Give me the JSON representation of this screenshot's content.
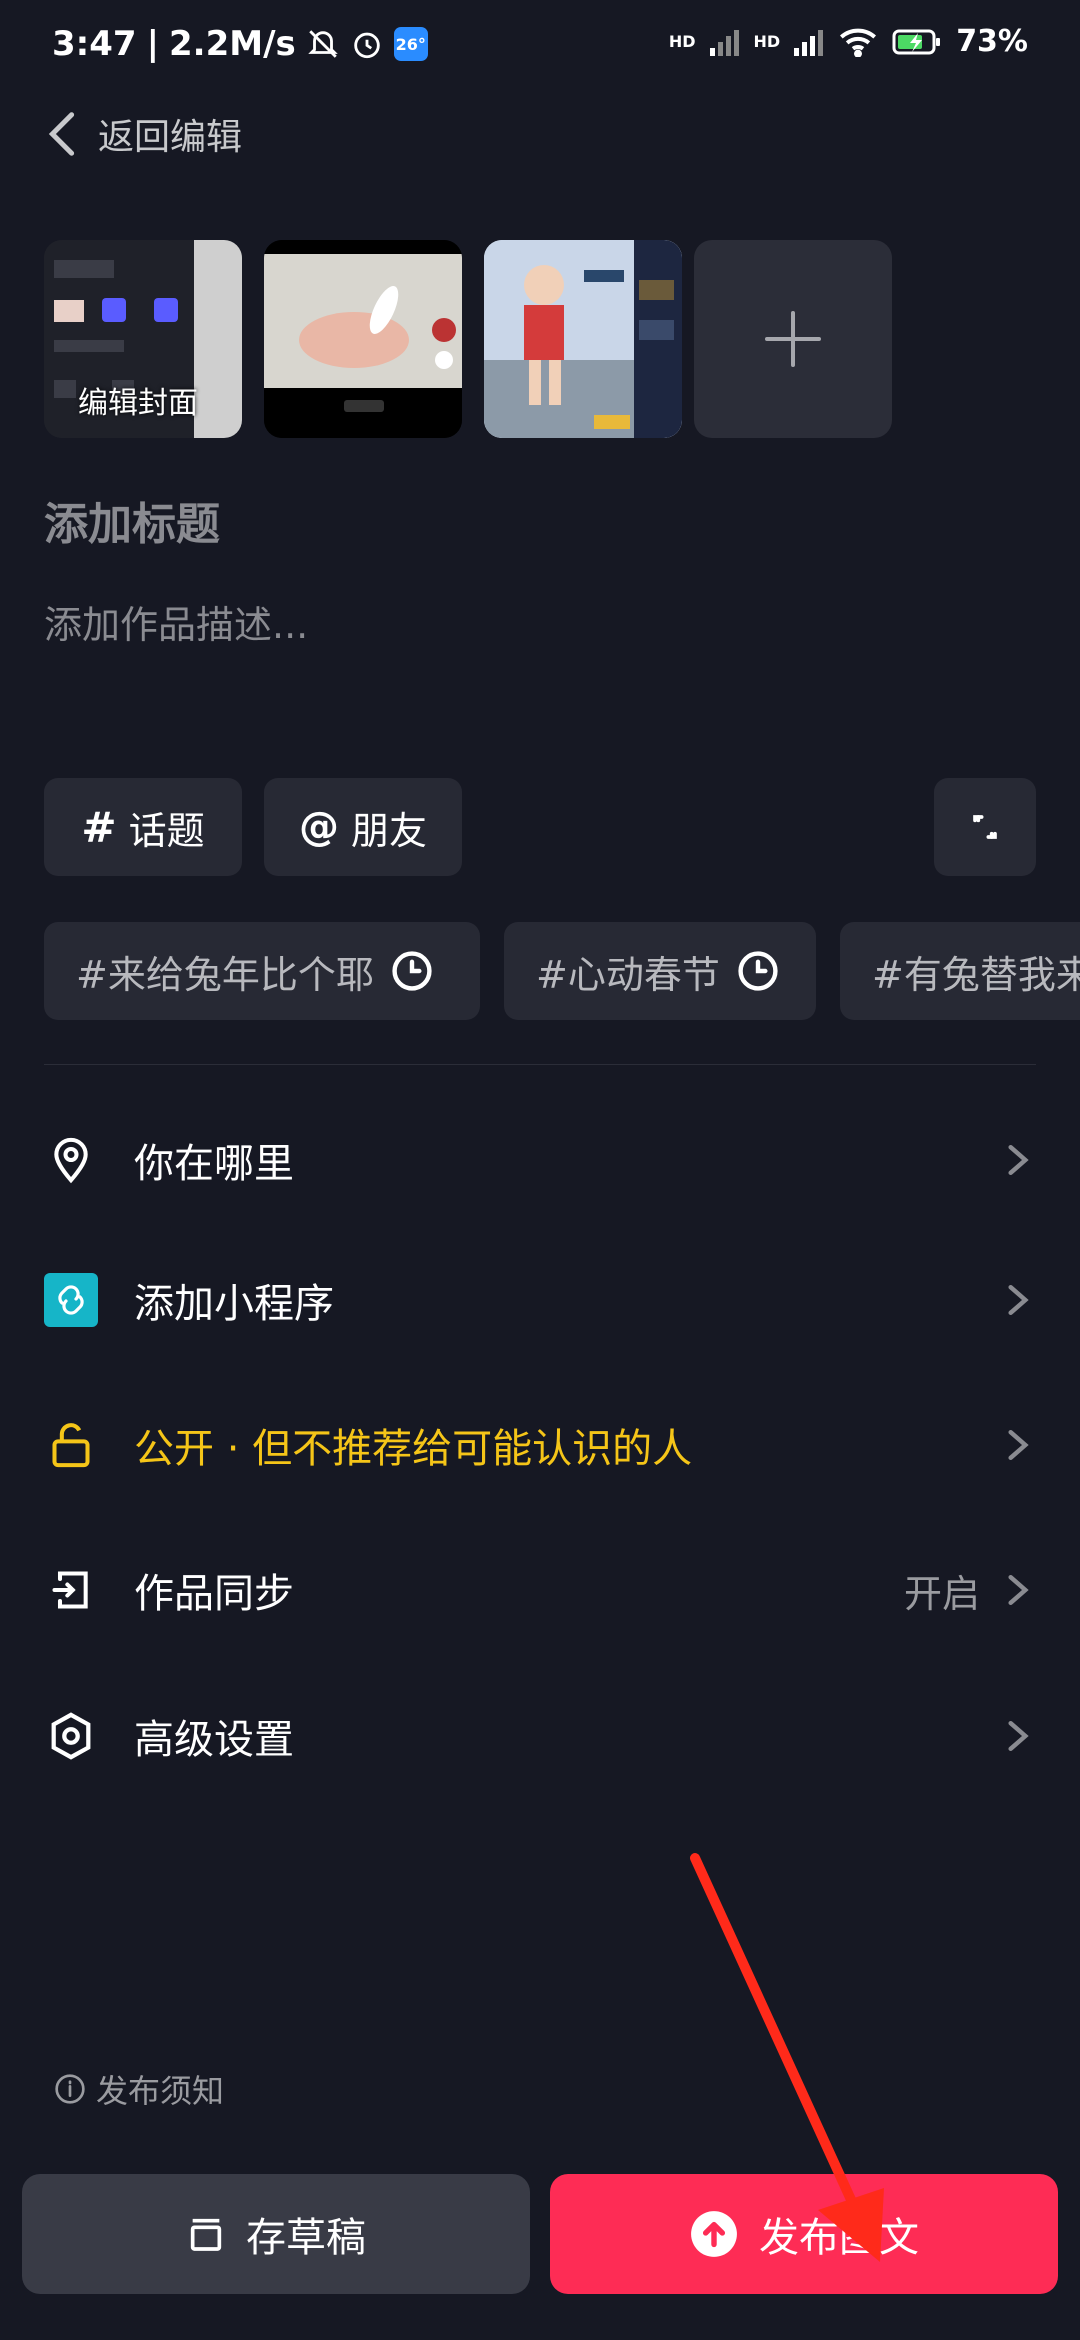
{
  "status_bar": {
    "time": "3:47",
    "speed": "2.2M/s",
    "weather_temp": "26°",
    "signal_tag_1": "HD",
    "signal_tag_2": "HD",
    "battery": "73%"
  },
  "nav": {
    "back_label": "返回编辑"
  },
  "media": {
    "cover_label": "编辑封面",
    "thumbnails": [
      "cover-image",
      "video-frame-image",
      "game-character-image"
    ]
  },
  "form": {
    "title_placeholder": "添加标题",
    "description_placeholder": "添加作品描述..."
  },
  "chips": {
    "topic": "话题",
    "topic_symbol": "#",
    "friend": "朋友",
    "friend_symbol": "@"
  },
  "suggested_topics": [
    "#来给兔年比个耶",
    "#心动春节",
    "#有兔替我来"
  ],
  "settings": {
    "location": "你在哪里",
    "mini_program": "添加小程序",
    "visibility": "公开 · 但不推荐给可能认识的人",
    "sync": "作品同步",
    "sync_value": "开启",
    "advanced": "高级设置"
  },
  "notice": "发布须知",
  "buttons": {
    "draft": "存草稿",
    "publish": "发布图文"
  },
  "colors": {
    "background": "#161823",
    "chip": "#272934",
    "publish": "#fe2c55",
    "visibility_accent": "#f5c518",
    "mini_program_icon": "#16b5c8",
    "annotation_arrow": "#ff2a1a"
  }
}
